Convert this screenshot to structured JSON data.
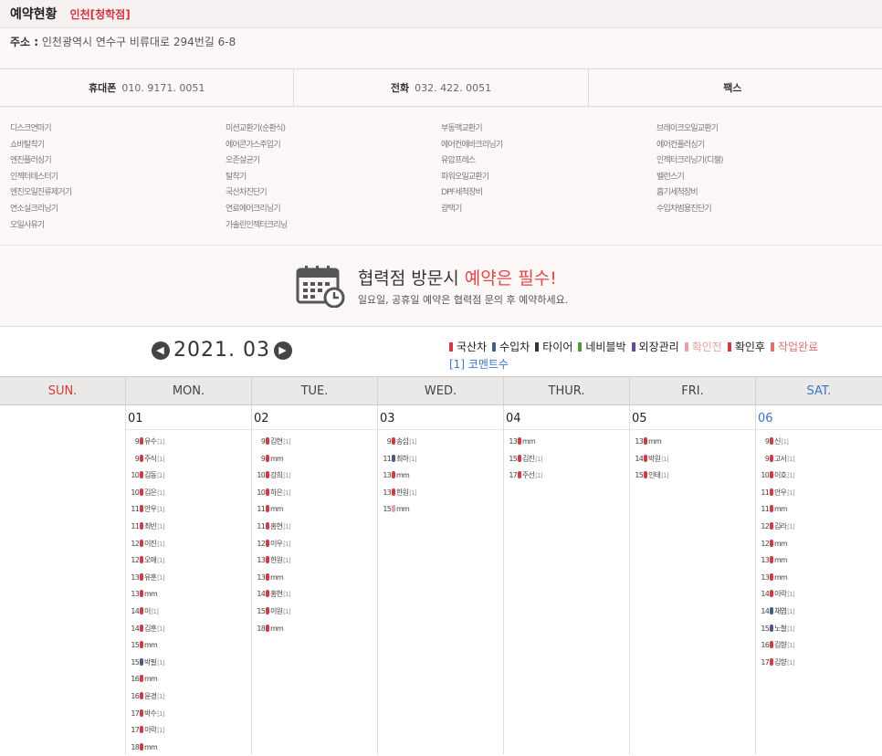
{
  "header": {
    "title": "예약현황",
    "branch": "인천[청학점]"
  },
  "address": {
    "label": "주소 :",
    "value": "인천광역시 연수구 비류대로 294번길 6-8"
  },
  "contact": {
    "mobile_label": "휴대폰",
    "mobile_value": "010. 9171. 0051",
    "phone_label": "전화",
    "phone_value": "032. 422. 0051",
    "fax_label": "팩스",
    "fax_value": ""
  },
  "services": [
    [
      "디스크연마기",
      "쇼바탈착기",
      "엔진플러싱기",
      "인젝터테스터기",
      "엔진오일진류제거기",
      "연소실크리닝기",
      "오일사유기"
    ],
    [
      "미션교환기(순환식)",
      "에어콘가스주입기",
      "오존살균기",
      "탈착기",
      "국산차진단기",
      "연료에어크리닝기",
      "가솔린인젝터크리닝"
    ],
    [
      "부동액교환기",
      "에어컨에바크리닝기",
      "유압프레스",
      "파워오일교환기",
      "DPF세척장비",
      "광택기"
    ],
    [
      "브레이크오일교환기",
      "에어컨플러싱기",
      "인젝터크리닝기(디젤)",
      "밸런스기",
      "흡기세척장비",
      "수입차범용진단기"
    ]
  ],
  "notice": {
    "headline_prefix": "협력점 방문시 ",
    "headline_highlight": "예약은 필수!",
    "sub": "일요일, 공휴일 예약은 협력점 문의 후 예약하세요."
  },
  "calendar": {
    "month": "2021. 03",
    "prev_icon": "chevron-left-icon",
    "next_icon": "chevron-right-icon",
    "legend": [
      {
        "label": "국산차",
        "color": "#d23a48"
      },
      {
        "label": "수입차",
        "color": "#4a5a8a"
      },
      {
        "label": "타이어",
        "color": "#333333"
      },
      {
        "label": "네비블박",
        "color": "#4a9a3a"
      },
      {
        "label": "외장관리",
        "color": "#6a4a9a"
      },
      {
        "label": "확인전",
        "color": "#e8a0a0"
      },
      {
        "label": "확인후",
        "color": "#d23a48"
      },
      {
        "label": "작업완료",
        "color": "#e07070"
      }
    ],
    "legend_comment": "[1] 코멘트수",
    "weekdays": [
      "SUN.",
      "MON.",
      "TUE.",
      "WED.",
      "THUR.",
      "FRI.",
      "SAT."
    ],
    "days": [
      {
        "date": "",
        "items": []
      },
      {
        "date": "01",
        "items": [
          {
            "time": "9",
            "color": "#d23a48",
            "name": "유수",
            "comment": "[1]"
          },
          {
            "time": "9",
            "color": "#d23a48",
            "name": "주식",
            "comment": "[1]"
          },
          {
            "time": "10",
            "color": "#d23a48",
            "name": "김동",
            "comment": "[1]"
          },
          {
            "time": "10",
            "color": "#d23a48",
            "name": "김은",
            "comment": "[1]"
          },
          {
            "time": "11",
            "color": "#d23a48",
            "name": "안우",
            "comment": "[1]"
          },
          {
            "time": "11",
            "color": "#d23a48",
            "name": "최빈",
            "comment": "[1]"
          },
          {
            "time": "12",
            "color": "#d23a48",
            "name": "이진",
            "comment": "[1]"
          },
          {
            "time": "12",
            "color": "#d23a48",
            "name": "오애",
            "comment": "[1]"
          },
          {
            "time": "13",
            "color": "#d23a48",
            "name": "유훈",
            "comment": "[1]"
          },
          {
            "time": "13",
            "color": "#d23a48",
            "name": "mm",
            "comment": ""
          },
          {
            "time": "14",
            "color": "#d23a48",
            "name": "이",
            "comment": "[1]"
          },
          {
            "time": "14",
            "color": "#d23a48",
            "name": "김훈",
            "comment": "[1]"
          },
          {
            "time": "15",
            "color": "#d23a48",
            "name": "mm",
            "comment": ""
          },
          {
            "time": "15",
            "color": "#4a5a8a",
            "name": "박필",
            "comment": "[1]"
          },
          {
            "time": "16",
            "color": "#d23a48",
            "name": "mm",
            "comment": ""
          },
          {
            "time": "16",
            "color": "#d23a48",
            "name": "윤경",
            "comment": "[1]"
          },
          {
            "time": "17",
            "color": "#d23a48",
            "name": "박수",
            "comment": "[1]"
          },
          {
            "time": "17",
            "color": "#d23a48",
            "name": "이락",
            "comment": "[1]"
          },
          {
            "time": "18",
            "color": "#d23a48",
            "name": "mm",
            "comment": ""
          }
        ]
      },
      {
        "date": "02",
        "items": [
          {
            "time": "9",
            "color": "#d23a48",
            "name": "김현",
            "comment": "[1]"
          },
          {
            "time": "9",
            "color": "#d23a48",
            "name": "mm",
            "comment": ""
          },
          {
            "time": "10",
            "color": "#d23a48",
            "name": "강희",
            "comment": "[1]"
          },
          {
            "time": "10",
            "color": "#d23a48",
            "name": "하은",
            "comment": "[1]"
          },
          {
            "time": "11",
            "color": "#d23a48",
            "name": "mm",
            "comment": ""
          },
          {
            "time": "11",
            "color": "#d23a48",
            "name": "홍현",
            "comment": "[1]"
          },
          {
            "time": "12",
            "color": "#d23a48",
            "name": "이우",
            "comment": "[1]"
          },
          {
            "time": "13",
            "color": "#d23a48",
            "name": "한원",
            "comment": "[1]"
          },
          {
            "time": "13",
            "color": "#d23a48",
            "name": "mm",
            "comment": ""
          },
          {
            "time": "14",
            "color": "#d23a48",
            "name": "홍현",
            "comment": "[1]"
          },
          {
            "time": "15",
            "color": "#d23a48",
            "name": "이원",
            "comment": "[1]"
          },
          {
            "time": "18",
            "color": "#d23a48",
            "name": "mm",
            "comment": ""
          }
        ]
      },
      {
        "date": "03",
        "items": [
          {
            "time": "9",
            "color": "#d23a48",
            "name": "송섭",
            "comment": "[1]"
          },
          {
            "time": "11",
            "color": "#4a5a8a",
            "name": "최하",
            "comment": "[1]"
          },
          {
            "time": "13",
            "color": "#d23a48",
            "name": "mm",
            "comment": ""
          },
          {
            "time": "13",
            "color": "#d23a48",
            "name": "한원",
            "comment": "[1]"
          },
          {
            "time": "15",
            "color": "#e8a0a0",
            "name": "mm",
            "comment": ""
          }
        ]
      },
      {
        "date": "04",
        "items": [
          {
            "time": "13",
            "color": "#d23a48",
            "name": "mm",
            "comment": ""
          },
          {
            "time": "15",
            "color": "#d23a48",
            "name": "김진",
            "comment": "[1]"
          },
          {
            "time": "17",
            "color": "#d23a48",
            "name": "주선",
            "comment": "[1]"
          }
        ]
      },
      {
        "date": "05",
        "items": [
          {
            "time": "13",
            "color": "#d23a48",
            "name": "mm",
            "comment": ""
          },
          {
            "time": "14",
            "color": "#d23a48",
            "name": "박원",
            "comment": "[1]"
          },
          {
            "time": "15",
            "color": "#d23a48",
            "name": "인태",
            "comment": "[1]"
          }
        ]
      },
      {
        "date": "06",
        "items": [
          {
            "time": "9",
            "color": "#d23a48",
            "name": "신",
            "comment": "[1]"
          },
          {
            "time": "9",
            "color": "#d23a48",
            "name": "고서",
            "comment": "[1]"
          },
          {
            "time": "10",
            "color": "#d23a48",
            "name": "이호",
            "comment": "[1]"
          },
          {
            "time": "11",
            "color": "#d23a48",
            "name": "안우",
            "comment": "[1]"
          },
          {
            "time": "11",
            "color": "#d23a48",
            "name": "mm",
            "comment": ""
          },
          {
            "time": "12",
            "color": "#d23a48",
            "name": "김라",
            "comment": "[1]"
          },
          {
            "time": "12",
            "color": "#d23a48",
            "name": "mm",
            "comment": ""
          },
          {
            "time": "13",
            "color": "#d23a48",
            "name": "mm",
            "comment": ""
          },
          {
            "time": "13",
            "color": "#d23a48",
            "name": "mm",
            "comment": ""
          },
          {
            "time": "14",
            "color": "#d23a48",
            "name": "이락",
            "comment": "[1]"
          },
          {
            "time": "14",
            "color": "#4a5a8a",
            "name": "채엽",
            "comment": "[1]"
          },
          {
            "time": "15",
            "color": "#4a5a8a",
            "name": "노철",
            "comment": "[1]"
          },
          {
            "time": "16",
            "color": "#d23a48",
            "name": "김향",
            "comment": "[1]"
          },
          {
            "time": "17",
            "color": "#d23a48",
            "name": "김향",
            "comment": "[1]"
          }
        ]
      }
    ]
  }
}
